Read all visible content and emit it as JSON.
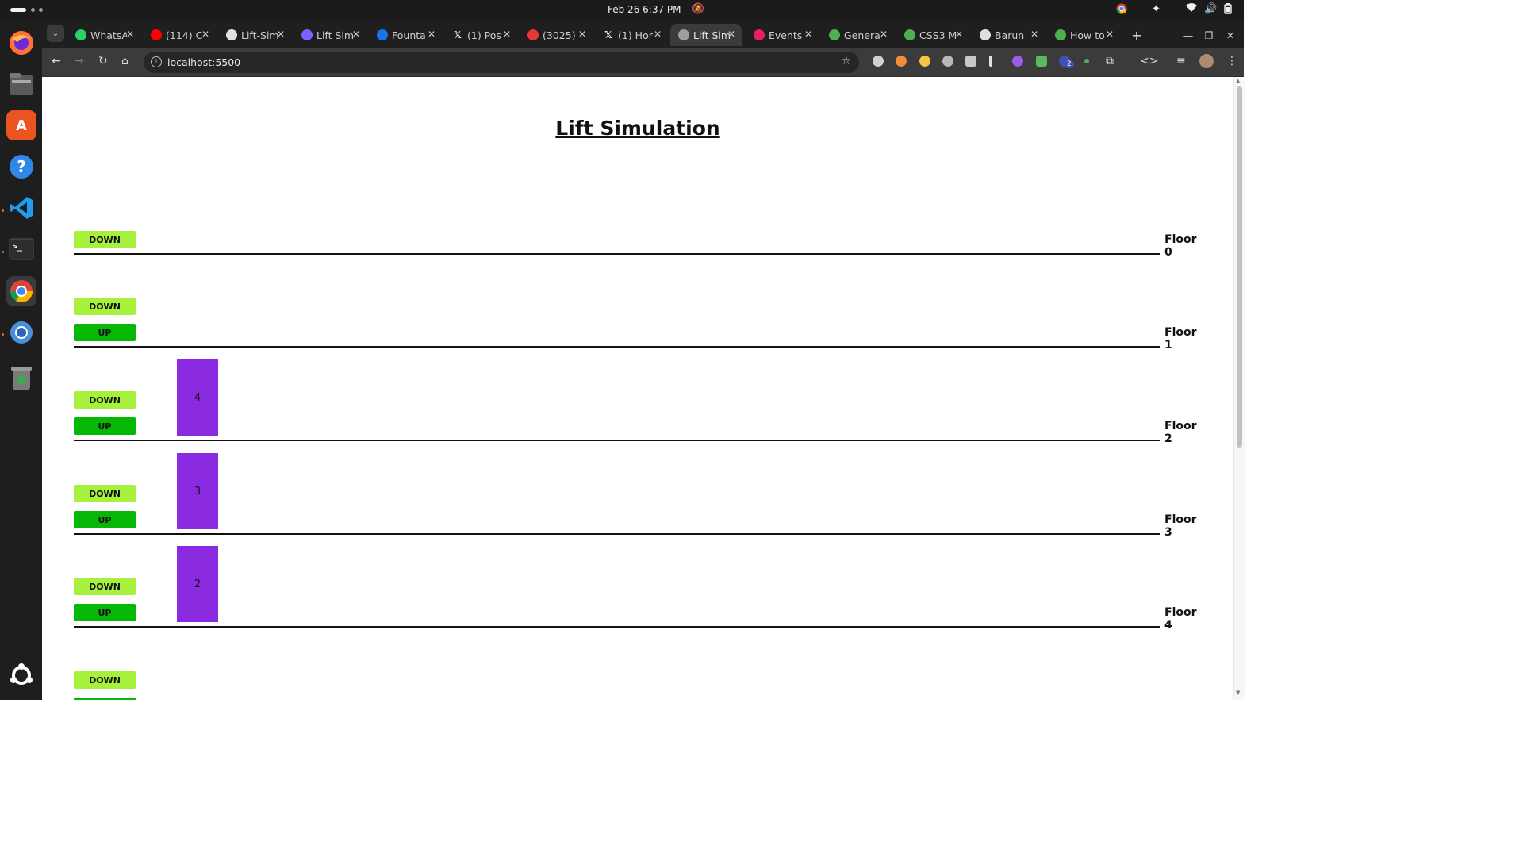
{
  "system": {
    "clock": "Feb 26   6:37 PM"
  },
  "browser": {
    "tabs": [
      {
        "label": "WhatsApp",
        "icon": "whatsapp-icon",
        "color": "#25d366"
      },
      {
        "label": "(114) C",
        "icon": "youtube-icon",
        "color": "#ff0000"
      },
      {
        "label": "Lift-Sim",
        "icon": "github-icon",
        "color": "#e0e0e0"
      },
      {
        "label": "Lift Sim",
        "icon": "site-icon",
        "color": "#7b61ff"
      },
      {
        "label": "Founta",
        "icon": "fountain-icon",
        "color": "#1a73e8"
      },
      {
        "label": "(1) Pos",
        "icon": "x-icon",
        "color": "#000000"
      },
      {
        "label": "(3025)",
        "icon": "site-icon",
        "color": "#e53935"
      },
      {
        "label": "(1) Hor",
        "icon": "x-icon",
        "color": "#000000"
      },
      {
        "label": "Lift Sim",
        "icon": "globe-icon",
        "color": "#9e9e9e",
        "active": true
      },
      {
        "label": "Events",
        "icon": "site-icon",
        "color": "#e91e63"
      },
      {
        "label": "Genera",
        "icon": "link-icon",
        "color": "#4caf50"
      },
      {
        "label": "CSS3 M",
        "icon": "w3-icon",
        "color": "#4caf50"
      },
      {
        "label": "Barun",
        "icon": "github-icon",
        "color": "#e0e0e0"
      },
      {
        "label": "How to",
        "icon": "link-icon",
        "color": "#4caf50"
      }
    ],
    "address": "localhost:5500",
    "extension_badge": "2"
  },
  "page": {
    "title": "Lift Simulation",
    "button_labels": {
      "down": "DOWN",
      "up": "UP"
    },
    "floors": [
      {
        "label": "Floor 0",
        "buttons": [
          "DOWN"
        ]
      },
      {
        "label": "Floor 1",
        "buttons": [
          "DOWN",
          "UP"
        ]
      },
      {
        "label": "Floor 2",
        "buttons": [
          "DOWN",
          "UP"
        ]
      },
      {
        "label": "Floor 3",
        "buttons": [
          "DOWN",
          "UP"
        ]
      },
      {
        "label": "Floor 4",
        "buttons": [
          "DOWN",
          "UP"
        ]
      },
      {
        "label": "",
        "buttons": [
          "DOWN",
          "UP"
        ]
      }
    ],
    "lifts": [
      {
        "label": "4",
        "floor": "Floor 2"
      },
      {
        "label": "3",
        "floor": "Floor 3"
      },
      {
        "label": "2",
        "floor": "Floor 4"
      }
    ],
    "colors": {
      "down_button": "#a7f03c",
      "up_button": "#05b805",
      "lift": "#8a2be2"
    }
  }
}
